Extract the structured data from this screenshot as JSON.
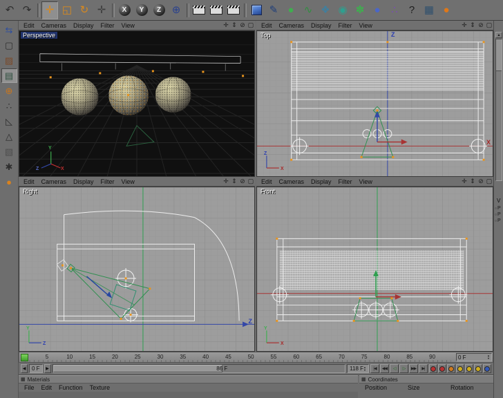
{
  "colors": {
    "ui_gray": "#707070",
    "viewport_bg": "#9c9c9c",
    "perspective_bg": "#101010",
    "axis_red": "#a83434",
    "axis_green": "#2fa050",
    "axis_blue": "#3448a8",
    "wireframe": "#ededed",
    "handle_orange": "#e8941e",
    "slider_green": "#4fae3a"
  },
  "icons": {
    "spinner_up": "▲",
    "spinner_down": "▼",
    "arrow_left": "◀",
    "arrow_right": "▶",
    "panel_grid": "▦",
    "dot": "○"
  },
  "main_toolbar": {
    "icons": [
      {
        "name": "undo-icon",
        "kind": "glyph",
        "glyph": "↶",
        "color": "#2e2e2e"
      },
      {
        "name": "redo-icon",
        "kind": "glyph",
        "glyph": "↷",
        "color": "#2e2e2e"
      },
      {
        "name": "toolbar-separator",
        "kind": "sep"
      },
      {
        "name": "move-tool-icon",
        "kind": "glyph",
        "glyph": "✛",
        "color": "#d98a1e",
        "state": "active"
      },
      {
        "name": "scale-tool-icon",
        "kind": "glyph",
        "glyph": "◱",
        "color": "#d98a1e"
      },
      {
        "name": "rotate-tool-icon",
        "kind": "glyph",
        "glyph": "↻",
        "color": "#d98a1e"
      },
      {
        "name": "last-tool-icon",
        "kind": "glyph",
        "glyph": "✛",
        "color": "#3d3d3d"
      },
      {
        "name": "toolbar-separator",
        "kind": "sep"
      },
      {
        "name": "lock-x-axis-icon",
        "kind": "ball",
        "glyph": "X"
      },
      {
        "name": "lock-y-axis-icon",
        "kind": "ball",
        "glyph": "Y"
      },
      {
        "name": "lock-z-axis-icon",
        "kind": "ball",
        "glyph": "Z"
      },
      {
        "name": "coordinate-system-icon",
        "kind": "glyph",
        "glyph": "⊕",
        "color": "#28408e"
      },
      {
        "name": "toolbar-separator",
        "kind": "sep"
      },
      {
        "name": "render-view-icon",
        "kind": "clapper"
      },
      {
        "name": "render-picture-viewer-icon",
        "kind": "clapper"
      },
      {
        "name": "render-settings-icon",
        "kind": "clapper"
      },
      {
        "name": "toolbar-separator",
        "kind": "sep"
      },
      {
        "name": "add-primitive-cube-icon",
        "kind": "cube"
      },
      {
        "name": "add-spline-icon",
        "kind": "glyph",
        "glyph": "✎",
        "color": "#1e3e7a"
      },
      {
        "name": "add-hypernurbs-icon",
        "kind": "glyph",
        "glyph": "●",
        "color": "#3fae4f"
      },
      {
        "name": "add-nurbs-icon",
        "kind": "glyph",
        "glyph": "∿",
        "color": "#2f8f3f"
      },
      {
        "name": "add-array-icon",
        "kind": "glyph",
        "glyph": "❖",
        "color": "#3f7f9f"
      },
      {
        "name": "add-instance-icon",
        "kind": "glyph",
        "glyph": "◉",
        "color": "#2f9f8f"
      },
      {
        "name": "add-metaball-icon",
        "kind": "glyph",
        "glyph": "✽",
        "color": "#3fae4f"
      },
      {
        "name": "add-environment-icon",
        "kind": "glyph",
        "glyph": "●",
        "color": "#4a66c8"
      },
      {
        "name": "add-particles-icon",
        "kind": "glyph",
        "glyph": "∴",
        "color": "#7a4fae"
      },
      {
        "name": "help-icon",
        "kind": "glyph",
        "glyph": "?",
        "color": "#1e1e1e"
      },
      {
        "name": "layout-icon",
        "kind": "glyph",
        "glyph": "▦",
        "color": "#30506e"
      },
      {
        "name": "material-ball-icon",
        "kind": "glyph",
        "glyph": "●",
        "color": "#e07818"
      }
    ]
  },
  "tool_palette": {
    "icons": [
      {
        "name": "make-editable-icon",
        "glyph": "⇆",
        "color": "#2e4e9e"
      },
      {
        "name": "model-mode-icon",
        "glyph": "▢",
        "color": "#2e2e2e"
      },
      {
        "name": "texture-mode-icon",
        "glyph": "▨",
        "color": "#7a4a2a"
      },
      {
        "name": "workplane-mode-icon",
        "glyph": "▤",
        "color": "#2e4e3e",
        "state": "active"
      },
      {
        "name": "object-axis-mode-icon",
        "glyph": "⊕",
        "color": "#c8761e"
      },
      {
        "name": "points-mode-icon",
        "glyph": "∴",
        "color": "#2e2e2e"
      },
      {
        "name": "edges-mode-icon",
        "glyph": "◺",
        "color": "#2e2e2e"
      },
      {
        "name": "polygons-mode-icon",
        "glyph": "△",
        "color": "#2e2e2e"
      },
      {
        "name": "texture-axis-mode-icon",
        "glyph": "▧",
        "color": "#4e4e4e"
      },
      {
        "name": "snap-settings-icon",
        "glyph": "✱",
        "color": "#2e2e2e"
      },
      {
        "name": "coordinate-manager-icon",
        "glyph": "●",
        "color": "#d9821e"
      }
    ]
  },
  "viewport": {
    "menu": [
      "Edit",
      "Cameras",
      "Display",
      "Filter",
      "View"
    ],
    "corner_icons": [
      {
        "name": "pan-view-icon",
        "glyph": "✛"
      },
      {
        "name": "zoom-view-icon",
        "glyph": "⇕"
      },
      {
        "name": "rotate-view-icon",
        "glyph": "⊘"
      },
      {
        "name": "toggle-view-icon",
        "glyph": "▢"
      }
    ],
    "panes": [
      {
        "label": "Perspective",
        "gizmo_y": "Y",
        "gizmo_x": "X",
        "gizmo_z": "Z"
      },
      {
        "label": "Top",
        "axis_vertical": "Z",
        "axis_horizontal": "X",
        "corner_v": "Z",
        "corner_h": "X"
      },
      {
        "label": "Right",
        "axis_horizontal": "Z",
        "corner_v": "Y",
        "corner_h": "Z"
      },
      {
        "label": "Front",
        "corner_v": "Y",
        "corner_h": "X"
      }
    ]
  },
  "timeline": {
    "ticks": [
      "5",
      "10",
      "15",
      "20",
      "25",
      "30",
      "35",
      "40",
      "45",
      "50",
      "55",
      "60",
      "65",
      "70",
      "75",
      "80",
      "85",
      "90"
    ],
    "current_frame_field": "0 F",
    "start_frame_field": "0 F",
    "range_label": "86 F",
    "end_frame_field": "118 F"
  },
  "transport": {
    "buttons": [
      {
        "name": "goto-start-button",
        "glyph": "|◀",
        "color": "#222222"
      },
      {
        "name": "previous-key-button",
        "glyph": "◀◀",
        "color": "#222222"
      },
      {
        "name": "previous-frame-button",
        "glyph": "◁",
        "color": "#1d6e1d"
      },
      {
        "name": "play-button",
        "glyph": "▷",
        "color": "#1d6e1d"
      },
      {
        "name": "next-frame-button",
        "glyph": "▶▶",
        "color": "#222222"
      },
      {
        "name": "goto-end-button",
        "glyph": "▶|",
        "color": "#222222"
      }
    ],
    "record_buttons": [
      {
        "name": "record-keyframe-button",
        "color": "#b83232"
      },
      {
        "name": "autokey-button",
        "color": "#b83232"
      },
      {
        "name": "record-position-button",
        "color": "#cf7a1e"
      },
      {
        "name": "record-scale-button",
        "color": "#cfae1e"
      },
      {
        "name": "record-rotation-button",
        "color": "#cfae1e"
      },
      {
        "name": "record-parameter-button",
        "color": "#cfae1e"
      },
      {
        "name": "record-point-level-button",
        "color": "#3258b8"
      }
    ]
  },
  "panels": {
    "materials": {
      "title": "Materials",
      "menu": [
        "File",
        "Edit",
        "Function",
        "Texture"
      ]
    },
    "coordinates": {
      "title": "Coordinates",
      "columns": [
        "Position",
        "Size",
        "Rotation"
      ]
    }
  },
  "side_panel": {
    "partial_title": "V",
    "rows": [
      "P",
      "P",
      "P"
    ]
  }
}
